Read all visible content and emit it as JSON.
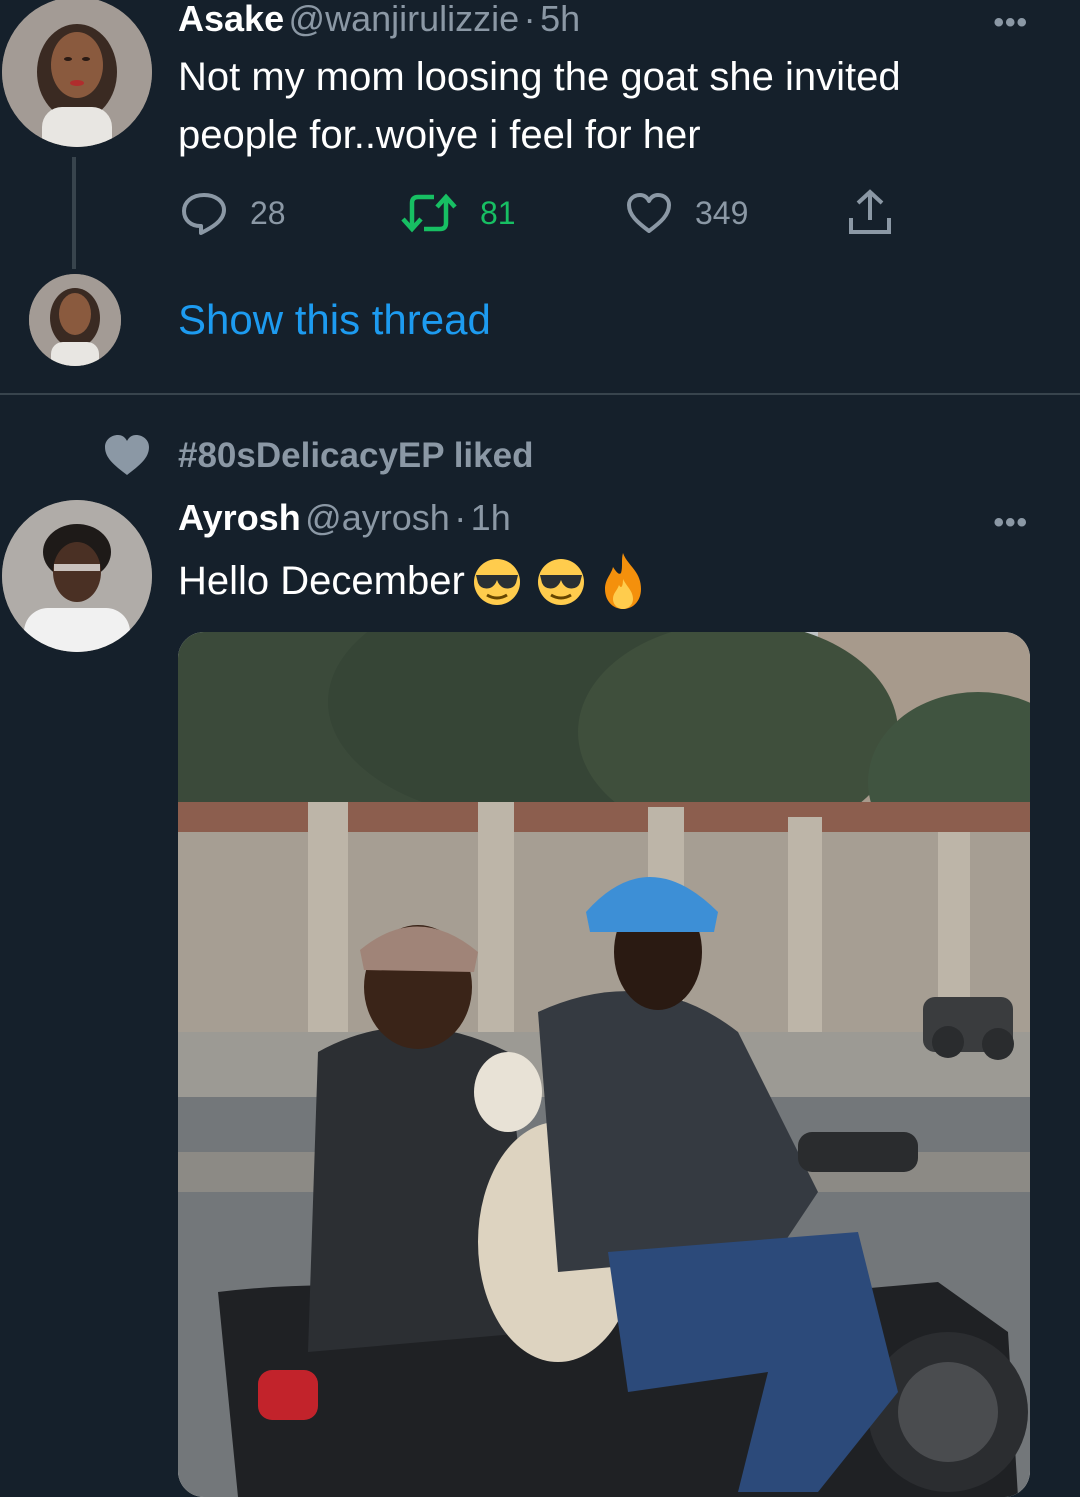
{
  "tweet1": {
    "name": "Asake",
    "handle": "@wanjirulizzie",
    "separator": "·",
    "time": "5h",
    "text_line1": "Not my mom loosing the goat she invited",
    "text_line2": "people for..woiye i feel for her",
    "replies": "28",
    "retweets": "81",
    "likes": "349",
    "more": "•••"
  },
  "thread": {
    "show_label": "Show this thread"
  },
  "social_context": {
    "text": "#80sDelicacyEP liked"
  },
  "tweet2": {
    "name": "Ayrosh",
    "handle": "@ayrosh",
    "separator": "·",
    "time": "1h",
    "text": "Hello December",
    "emojis": [
      "sunglasses-emoji",
      "sunglasses-emoji",
      "fire-emoji"
    ],
    "more": "•••"
  },
  "colors": {
    "background": "#15202b",
    "link": "#1d9bf0",
    "retweet": "#17bf63",
    "muted": "#8b98a5",
    "divider": "#38444d"
  }
}
